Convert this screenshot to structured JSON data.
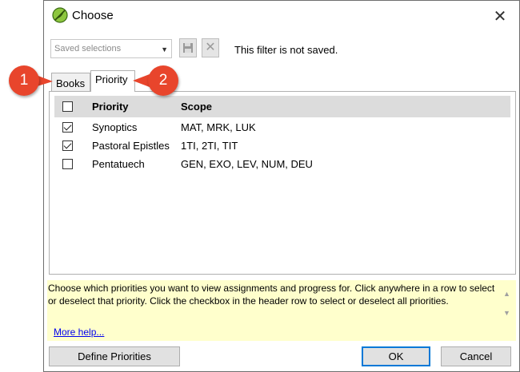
{
  "window": {
    "title": "Choose",
    "close_icon": "close-icon"
  },
  "toolbar": {
    "saved_selections_placeholder": "Saved selections",
    "save_icon": "floppy-disk-icon",
    "delete_icon": "x-icon",
    "filter_status": "This filter is not saved."
  },
  "tabs": [
    {
      "label": "Books",
      "active": false
    },
    {
      "label": "Priority",
      "active": true
    }
  ],
  "grid": {
    "headers": {
      "priority": "Priority",
      "scope": "Scope"
    },
    "header_checked": false,
    "rows": [
      {
        "checked": true,
        "priority": "Synoptics",
        "scope": "MAT, MRK, LUK"
      },
      {
        "checked": true,
        "priority": "Pastoral Epistles",
        "scope": "1TI, 2TI, TIT"
      },
      {
        "checked": false,
        "priority": "Pentatuech",
        "scope": "GEN, EXO, LEV, NUM, DEU"
      }
    ]
  },
  "help": {
    "text": "Choose which priorities you want to view assignments and progress for. Click anywhere in a row to select or deselect that priority. Click the checkbox in the header row to select or deselect all priorities.",
    "link": "More help..."
  },
  "buttons": {
    "define": "Define Priorities",
    "ok": "OK",
    "cancel": "Cancel"
  },
  "callouts": [
    "1",
    "2"
  ],
  "colors": {
    "callout": "#e8452c",
    "help_background": "#ffffcc",
    "header_background": "#dcdcdc",
    "link": "#0000ee"
  }
}
